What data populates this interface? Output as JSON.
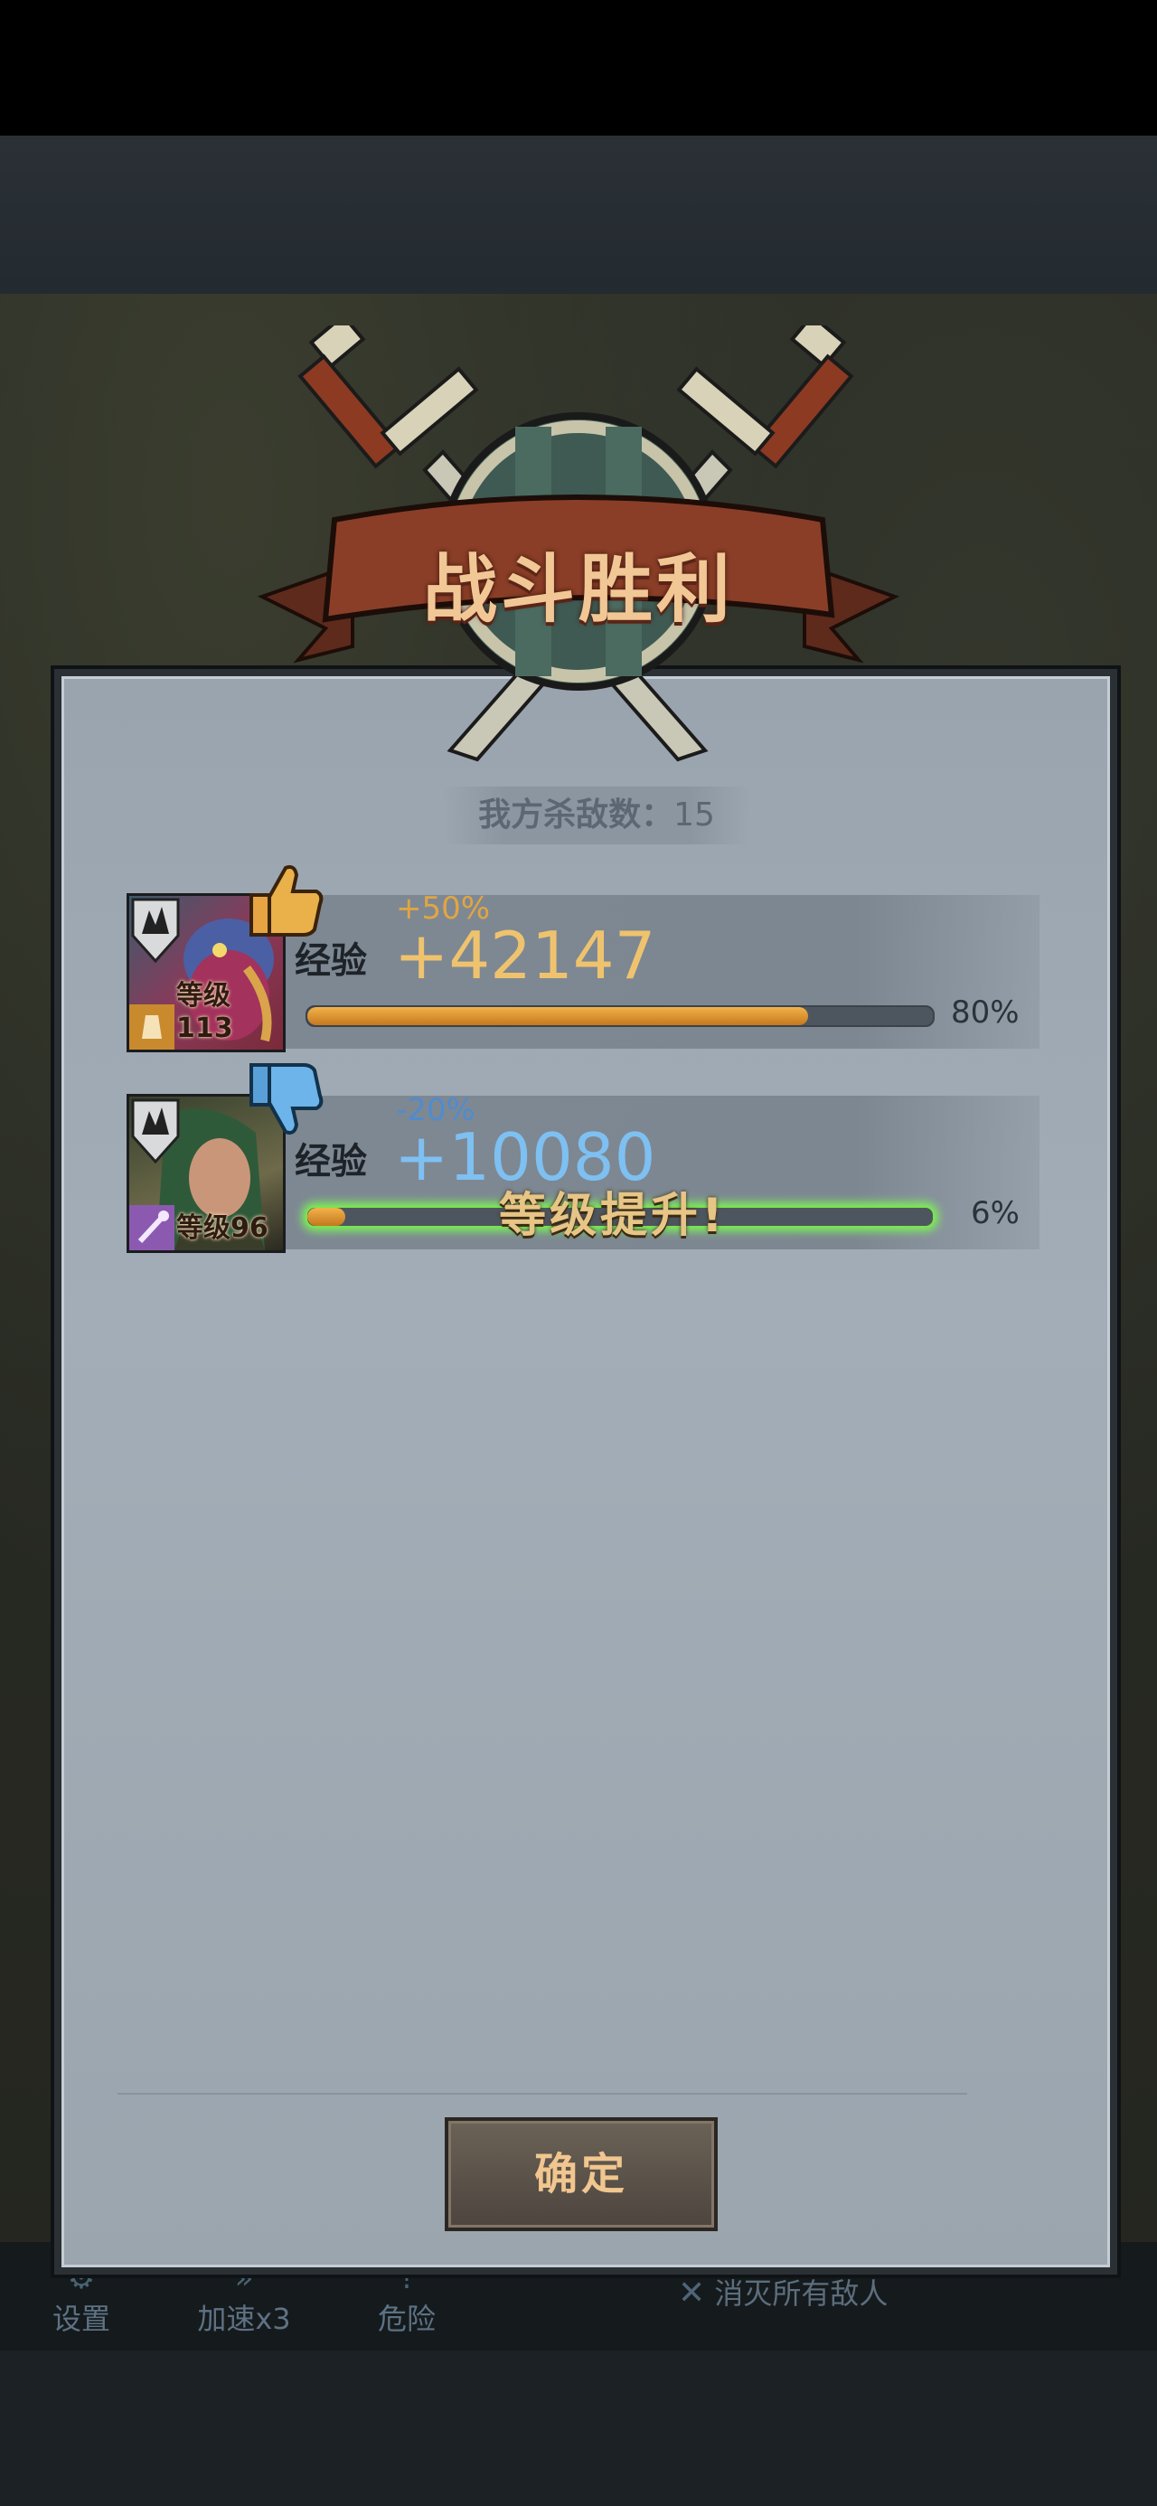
{
  "title": "战斗胜利",
  "kills": {
    "label": "我方杀敌数：",
    "value": "15"
  },
  "heroes": [
    {
      "bonus": "+50%",
      "exp_label": "经验",
      "exp_gain": "+42147",
      "level_label": "等级113",
      "progress": 0.8,
      "progress_text": "80%",
      "thumb": "thumbs-up",
      "color": "#e8b14d"
    },
    {
      "bonus": "-20%",
      "exp_label": "经验",
      "exp_gain": "+10080",
      "level_label": "等级96",
      "progress": 0.06,
      "progress_text": "6%",
      "thumb": "thumbs-down",
      "levelup": "等级提升!",
      "color": "#5aa8e0"
    }
  ],
  "confirm_label": "确定",
  "bottom_bar": {
    "settings": "设置",
    "speed": "加速x3",
    "danger": "危险",
    "objective": "消灭所有敌人"
  }
}
